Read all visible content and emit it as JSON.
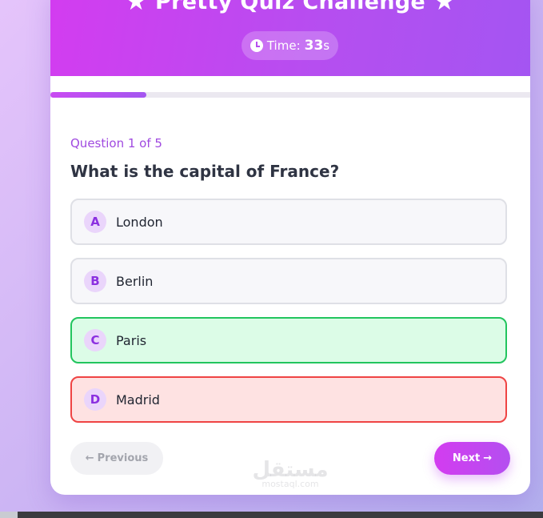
{
  "header": {
    "title": "Pretty Quiz Challenge",
    "star_left": "★",
    "star_right": "★",
    "timer_label": "Time:",
    "timer_value": "33",
    "timer_unit": "s",
    "icon": "clock-icon"
  },
  "progress": {
    "fraction": 0.2
  },
  "question": {
    "counter": "Question 1 of 5",
    "text": "What is the capital of France?"
  },
  "options": [
    {
      "letter": "A",
      "label": "London",
      "state": "neutral"
    },
    {
      "letter": "B",
      "label": "Berlin",
      "state": "neutral"
    },
    {
      "letter": "C",
      "label": "Paris",
      "state": "correct"
    },
    {
      "letter": "D",
      "label": "Madrid",
      "state": "wrong"
    }
  ],
  "nav": {
    "prev_label": "Previous",
    "prev_arrow": "←",
    "next_label": "Next",
    "next_arrow": "→"
  },
  "watermark": {
    "main": "مستقل",
    "sub": "mostaql.com"
  },
  "colors": {
    "accent": "#c94af2",
    "correct_border": "#22c55e",
    "correct_bg": "#dcfce7",
    "wrong_border": "#ef4444",
    "wrong_bg": "#fee2e2"
  }
}
